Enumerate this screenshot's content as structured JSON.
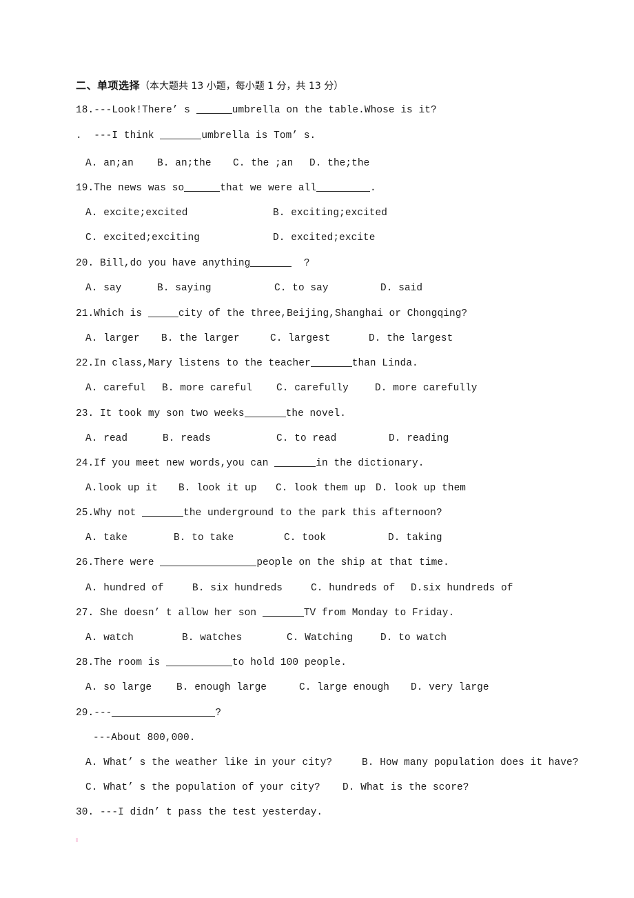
{
  "document": {
    "section_heading": {
      "title": "二、单项选择",
      "meta": "（本大题共 13 小题，每小题 1 分，共 13 分）"
    },
    "stray_mark": "."
  },
  "questions": [
    {
      "number": "18.",
      "stem_line1": "18.---Look!There’ s ",
      "stem_line1_tail": "umbrella on the table.Whose is it?",
      "stem_line2_prefix": ".  ---I think ",
      "stem_line2_tail": "umbrella is Tom’ s.",
      "options": [
        "A. an;an",
        "B. an;the",
        "C. the ;an",
        "D. the;the"
      ]
    },
    {
      "number": "19.",
      "stem_head": "19.The news was so",
      "stem_mid": "that we were all",
      "stem_tail": ".",
      "options_row1": [
        "A. excite;excited",
        "B. exciting;excited"
      ],
      "options_row2": [
        "C. excited;exciting",
        "D. excited;excite"
      ]
    },
    {
      "number": "20.",
      "stem_head": "20. Bill,do you have anything",
      "stem_tail": "  ?",
      "options": [
        "A. say",
        "B. saying",
        "C. to say",
        "D. said"
      ]
    },
    {
      "number": "21.",
      "stem_head": "21.Which is ",
      "stem_tail": "city of the three,Beijing,Shanghai or Chongqing?",
      "options": [
        "A. larger",
        "B. the larger",
        "C. largest",
        "D. the largest"
      ]
    },
    {
      "number": "22.",
      "stem_head": "22.In class,Mary listens to the teacher",
      "stem_tail": "than Linda.",
      "options": [
        "A. careful",
        "B. more careful",
        "C. carefully",
        "D. more carefully"
      ]
    },
    {
      "number": "23.",
      "stem_head": "23. It took my son two weeks",
      "stem_tail": "the novel.",
      "options": [
        "A. read",
        "B. reads",
        "C. to read",
        "D. reading"
      ]
    },
    {
      "number": "24.",
      "stem_head": "24.If you meet new words,you can ",
      "stem_tail": "in the dictionary.",
      "options": [
        "A.look up it",
        "B. look it up",
        "C. look them up",
        "D. look up them"
      ]
    },
    {
      "number": "25.",
      "stem_head": "25.Why not ",
      "stem_tail": "the underground to the park this afternoon?",
      "options": [
        "A. take",
        "B. to take",
        "C. took",
        "D. taking"
      ]
    },
    {
      "number": "26.",
      "stem_head": "26.There were ",
      "stem_tail": "people on the ship at that time.",
      "options": [
        "A. hundred of",
        "B. six hundreds",
        "C. hundreds of",
        "D.six hundreds of"
      ]
    },
    {
      "number": "27.",
      "stem_head": "27. She doesn’ t allow her son ",
      "stem_tail": "TV from Monday to Friday.",
      "options": [
        "A. watch",
        "B. watches",
        "C. Watching",
        "D. to watch"
      ]
    },
    {
      "number": "28.",
      "stem_head": "28.The room is ",
      "stem_tail": "to hold 100 people.",
      "options": [
        "A. so large",
        "B. enough large",
        "C. large enough",
        "D. very large"
      ]
    },
    {
      "number": "29.",
      "stem_head": "29.---",
      "stem_tail": "?",
      "answer_line": "---About 800,000.",
      "options_row1": [
        "A. What’ s the weather like in your city?",
        "B. How many population does it have?"
      ],
      "options_row2": [
        "C. What’ s the population of your city?",
        "D. What is the score?"
      ]
    },
    {
      "number": "30.",
      "stem_head": "30. ---I didn’ t pass the test yesterday."
    }
  ]
}
